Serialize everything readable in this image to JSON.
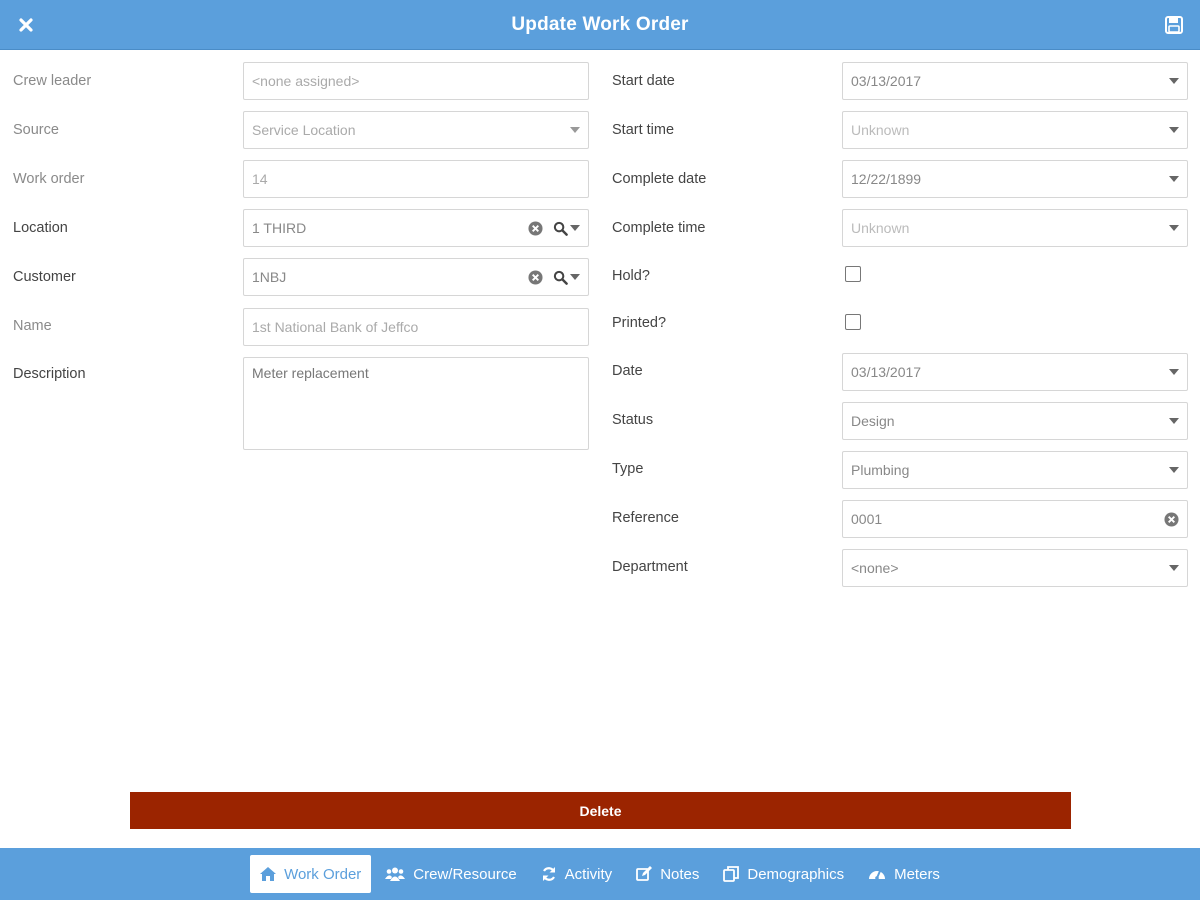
{
  "header": {
    "title": "Update Work Order",
    "close_icon": "close-icon",
    "save_icon": "save-icon"
  },
  "left": {
    "crew_leader": {
      "label": "Crew leader",
      "value": "<none assigned>"
    },
    "source": {
      "label": "Source",
      "value": "Service Location"
    },
    "work_order": {
      "label": "Work order",
      "value": "14"
    },
    "location": {
      "label": "Location",
      "value": "1 THIRD"
    },
    "customer": {
      "label": "Customer",
      "value": "1NBJ"
    },
    "name": {
      "label": "Name",
      "value": "1st National Bank of Jeffco"
    },
    "description": {
      "label": "Description",
      "value": "Meter replacement"
    }
  },
  "right": {
    "start_date": {
      "label": "Start date",
      "value": "03/13/2017"
    },
    "start_time": {
      "label": "Start time",
      "value": "Unknown"
    },
    "complete_date": {
      "label": "Complete date",
      "value": "12/22/1899"
    },
    "complete_time": {
      "label": "Complete time",
      "value": "Unknown"
    },
    "hold": {
      "label": "Hold?",
      "checked": false
    },
    "printed": {
      "label": "Printed?",
      "checked": false
    },
    "date": {
      "label": "Date",
      "value": "03/13/2017"
    },
    "status": {
      "label": "Status",
      "value": "Design"
    },
    "type": {
      "label": "Type",
      "value": "Plumbing"
    },
    "reference": {
      "label": "Reference",
      "value": "0001"
    },
    "department": {
      "label": "Department",
      "value": "<none>"
    }
  },
  "delete_label": "Delete",
  "tabs": [
    {
      "label": "Work Order",
      "icon": "home-icon",
      "active": true
    },
    {
      "label": "Crew/Resource",
      "icon": "users-icon",
      "active": false
    },
    {
      "label": "Activity",
      "icon": "refresh-icon",
      "active": false
    },
    {
      "label": "Notes",
      "icon": "edit-icon",
      "active": false
    },
    {
      "label": "Demographics",
      "icon": "copy-icon",
      "active": false
    },
    {
      "label": "Meters",
      "icon": "dashboard-icon",
      "active": false
    }
  ],
  "colors": {
    "accent": "#5b9fdc",
    "danger": "#9b2400"
  }
}
